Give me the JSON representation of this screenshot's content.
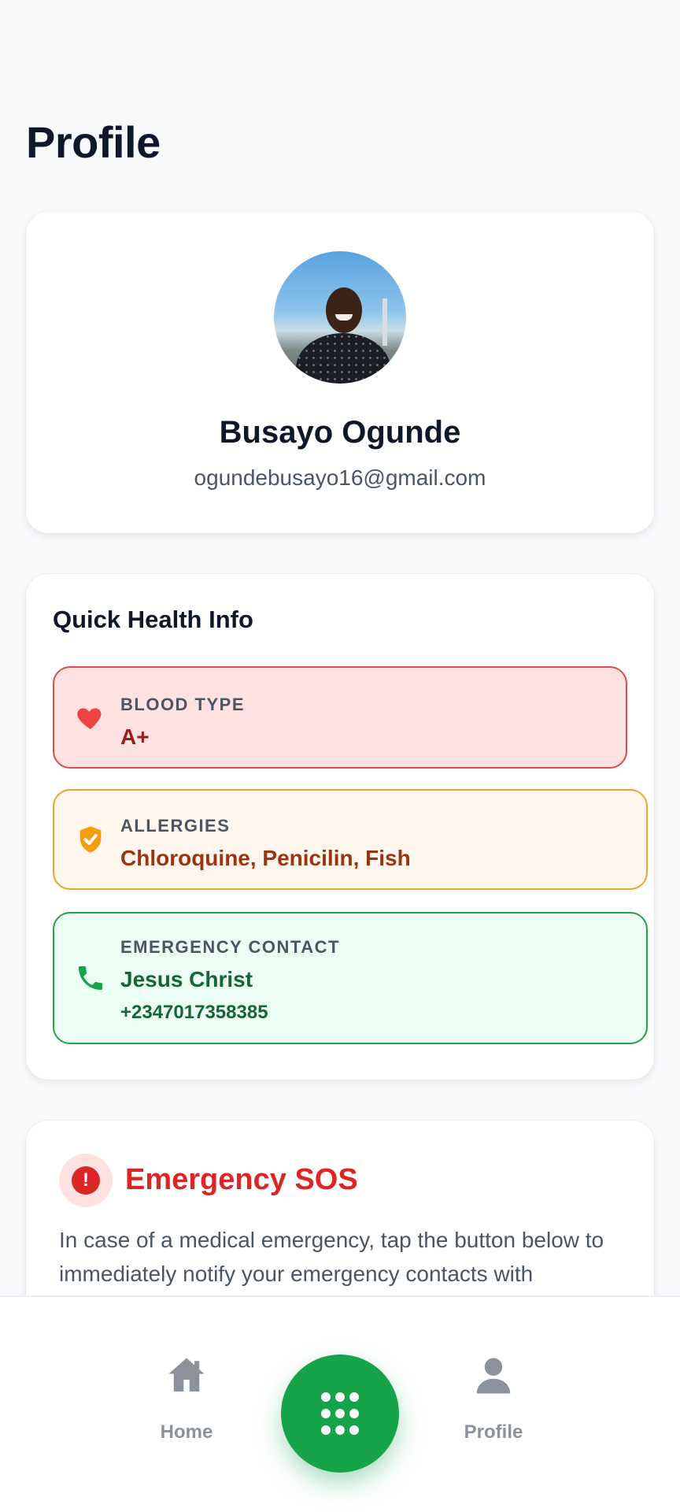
{
  "page": {
    "title": "Profile"
  },
  "profile": {
    "name": "Busayo Ogunde",
    "email": "ogundebusayo16@gmail.com",
    "avatar": "profile-photo"
  },
  "health_info": {
    "title": "Quick Health Info",
    "blood_type": {
      "label": "BLOOD TYPE",
      "value": "A+",
      "icon": "heart-icon",
      "color": "#dc4c4c"
    },
    "allergies": {
      "label": "ALLERGIES",
      "value": "Chloroquine, Penicilin, Fish",
      "icon": "shield-check-icon",
      "color": "#eaa52f"
    },
    "emergency_contact": {
      "label": "EMERGENCY CONTACT",
      "name": "Jesus Christ",
      "phone": "+2347017358385",
      "icon": "phone-icon",
      "color": "#22a34a"
    }
  },
  "sos": {
    "icon_glyph": "!",
    "title": "Emergency SOS",
    "description": "In case of a medical emergency, tap the button below to immediately notify your emergency contacts with"
  },
  "nav": {
    "home_label": "Home",
    "profile_label": "Profile",
    "center_icon": "grid-dots-icon",
    "accent": "#16a34a"
  }
}
